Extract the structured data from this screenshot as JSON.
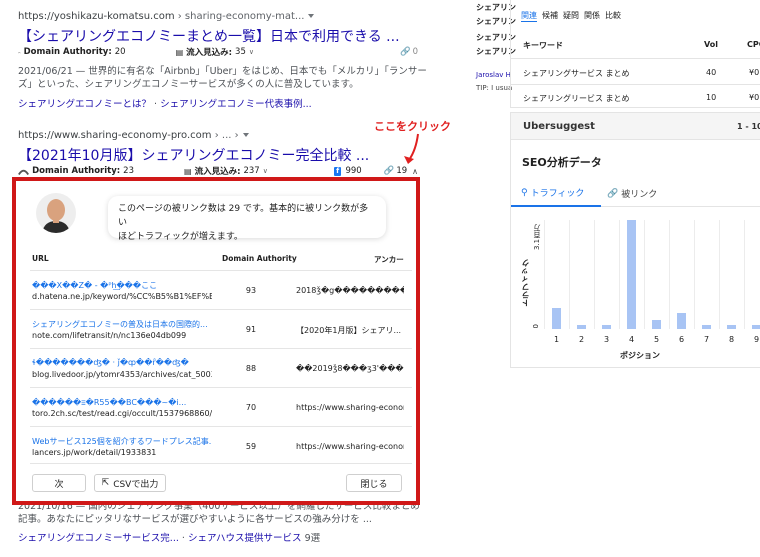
{
  "results": {
    "r1": {
      "url_host": "https://yoshikazu-komatsu.com",
      "url_crumb": " › sharing-economy-mat...",
      "title": "【シェアリングエコノミーまとめ一覧】日本で利用できる ...",
      "da_label": "Domain Authority:",
      "da_value": "20",
      "traffic_label": "流入見込み:",
      "traffic_value": "35",
      "links_count": "0",
      "snippet_line1": "2021/06/21 — 世界的に有名な「Airbnb」「Uber」をはじめ、日本でも「メルカリ」「ランサー",
      "snippet_line2": "ズ」といった、シェアリングエコノミーサービスが多くの人に普及しています。",
      "sublink1": "シェアリングエコノミーとは？",
      "sublink_sep": " · ",
      "sublink2": "シェアリングエコノミー代表事例..."
    },
    "r2": {
      "url_host": "https://www.sharing-economy-pro.com",
      "url_crumb": " › ... ›",
      "title": "【2021年10月版】シェアリングエコノミー完全比較 ...",
      "da_label": "Domain Authority:",
      "da_value": "23",
      "traffic_label": "流入見込み:",
      "traffic_value": "237",
      "fb_count": "990",
      "links_count": "19",
      "snippet_line1": "2021/10/16 — 国内のシェアリング事業（400サービス以上）を網羅したサービス比較まとめ",
      "snippet_line2": "記事。あなたにピッタリなサービスが選びやすいように各サービスの強み分けを ...",
      "sublink1": "シェアリングエコノミーサービス完...",
      "sublink_sep": " · ",
      "sublink2": "シェアハウス提供サービス",
      "sublink2_count": " 9選"
    }
  },
  "annotation": "ここをクリック",
  "popup": {
    "message_line1": "このページの被リンク数は 29 です。基本的に被リンク数が多い",
    "message_line2": "ほどトラフィックが増えます。",
    "col_url": "URL",
    "col_da": "Domain Authority",
    "col_anchor": "アンカー",
    "rows": [
      {
        "title": "���X��Z� - �ᴾh͢���ここ",
        "url": "d.hatena.ne.jp/keyword/%CC%B5%B1%EF%BC...",
        "da": "93",
        "anchor": "2018ǯ�g����������..."
      },
      {
        "title": "シェアリングエコノミーの普及は日本の国際的...",
        "url": "note.com/lifetransit/n/nc136e04db099",
        "da": "91",
        "anchor": "【2020年1月版】シェアリ..."
      },
      {
        "title": "ɬ�������ʤ� · ǰ�ȹ��ȓ��ʤ�",
        "url": "blog.livedoor.jp/ytomr4353/archives/cat_500348...",
        "da": "88",
        "anchor": "��2019ǯ8���ʒ3'���..."
      },
      {
        "title": "������ⲷ�R55��BC���~�i...",
        "url": "toro.2ch.sc/test/read.cgi/occult/1537968860/",
        "da": "70",
        "anchor": "https://www.sharing-econom..."
      },
      {
        "title": "Webサービス125個を紹介するワードプレス記事...",
        "url": "lancers.jp/work/detail/1933831",
        "da": "59",
        "anchor": "https://www.sharing-econom..."
      }
    ],
    "next_label": "次",
    "csv_label": "CSVで出力",
    "close_label": "閉じる"
  },
  "right": {
    "stacked_items": [
      "シェアリン",
      "シェアリン",
      "シェアリン",
      "シェアリン"
    ],
    "tabs": [
      "関連",
      "候補",
      "疑問",
      "関係",
      "比較"
    ],
    "kw_col_keyword": "キーワード",
    "kw_col_vol": "Vol",
    "kw_col_cpc": "CPC",
    "keywords": [
      {
        "keyword": "シェアリングサービス まとめ",
        "vol": "40",
        "cpc": "¥0"
      },
      {
        "keyword": "シェアリングリービス まとめ",
        "vol": "10",
        "cpc": "¥0"
      }
    ],
    "jaroslav": "Jaroslav H",
    "tip": "TIP: I usua",
    "ubersuggest_title": "Ubersuggest",
    "ubersuggest_range": "1 - 10 /",
    "seo_title": "SEO分析データ",
    "tab_traffic": "トラフィック",
    "tab_backlinks": "被リンク"
  },
  "chart_data": {
    "type": "bar",
    "categories": [
      "1",
      "2",
      "3",
      "4",
      "5",
      "6",
      "7",
      "8",
      "9"
    ],
    "values": [
      0.6,
      0.1,
      0.1,
      3.1,
      0.25,
      0.45,
      0.1,
      0.1,
      0.1
    ],
    "ylabel": "トラフィック",
    "xlabel": "ポジション",
    "ytick_top": "3.1百万",
    "ytick_bottom": "0",
    "ylim": [
      0,
      3.1
    ],
    "grid": true
  }
}
